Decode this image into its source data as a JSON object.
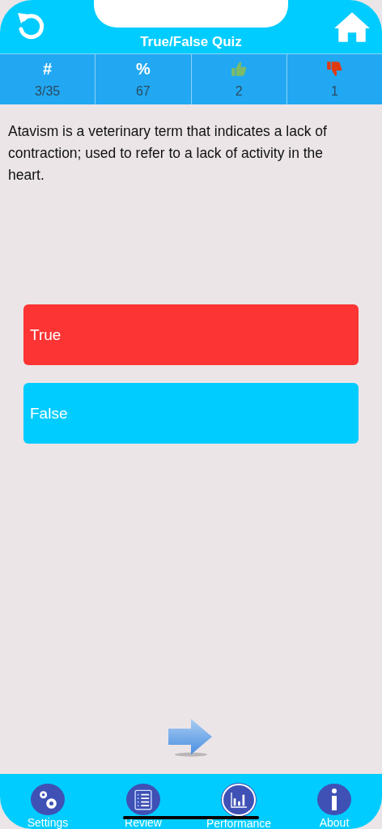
{
  "header": {
    "title": "True/False Quiz"
  },
  "stats": [
    {
      "kind": "count",
      "label": "#",
      "value": "3/35"
    },
    {
      "kind": "percent",
      "label": "%",
      "value": "67"
    },
    {
      "kind": "up",
      "value": "2"
    },
    {
      "kind": "down",
      "value": "1"
    }
  ],
  "question": "Atavism is a veterinary term that indicates a lack of contraction; used to refer to a lack of activity in the heart.",
  "answers": [
    {
      "label": "True",
      "color": "#fc3434"
    },
    {
      "label": "False",
      "color": "#00ccff"
    }
  ],
  "tabs": [
    {
      "kind": "settings",
      "label": "Settings",
      "selected": false
    },
    {
      "kind": "review",
      "label": "Review",
      "selected": false
    },
    {
      "kind": "performance",
      "label": "Performance",
      "selected": true
    },
    {
      "kind": "about",
      "label": "About",
      "selected": false
    }
  ]
}
